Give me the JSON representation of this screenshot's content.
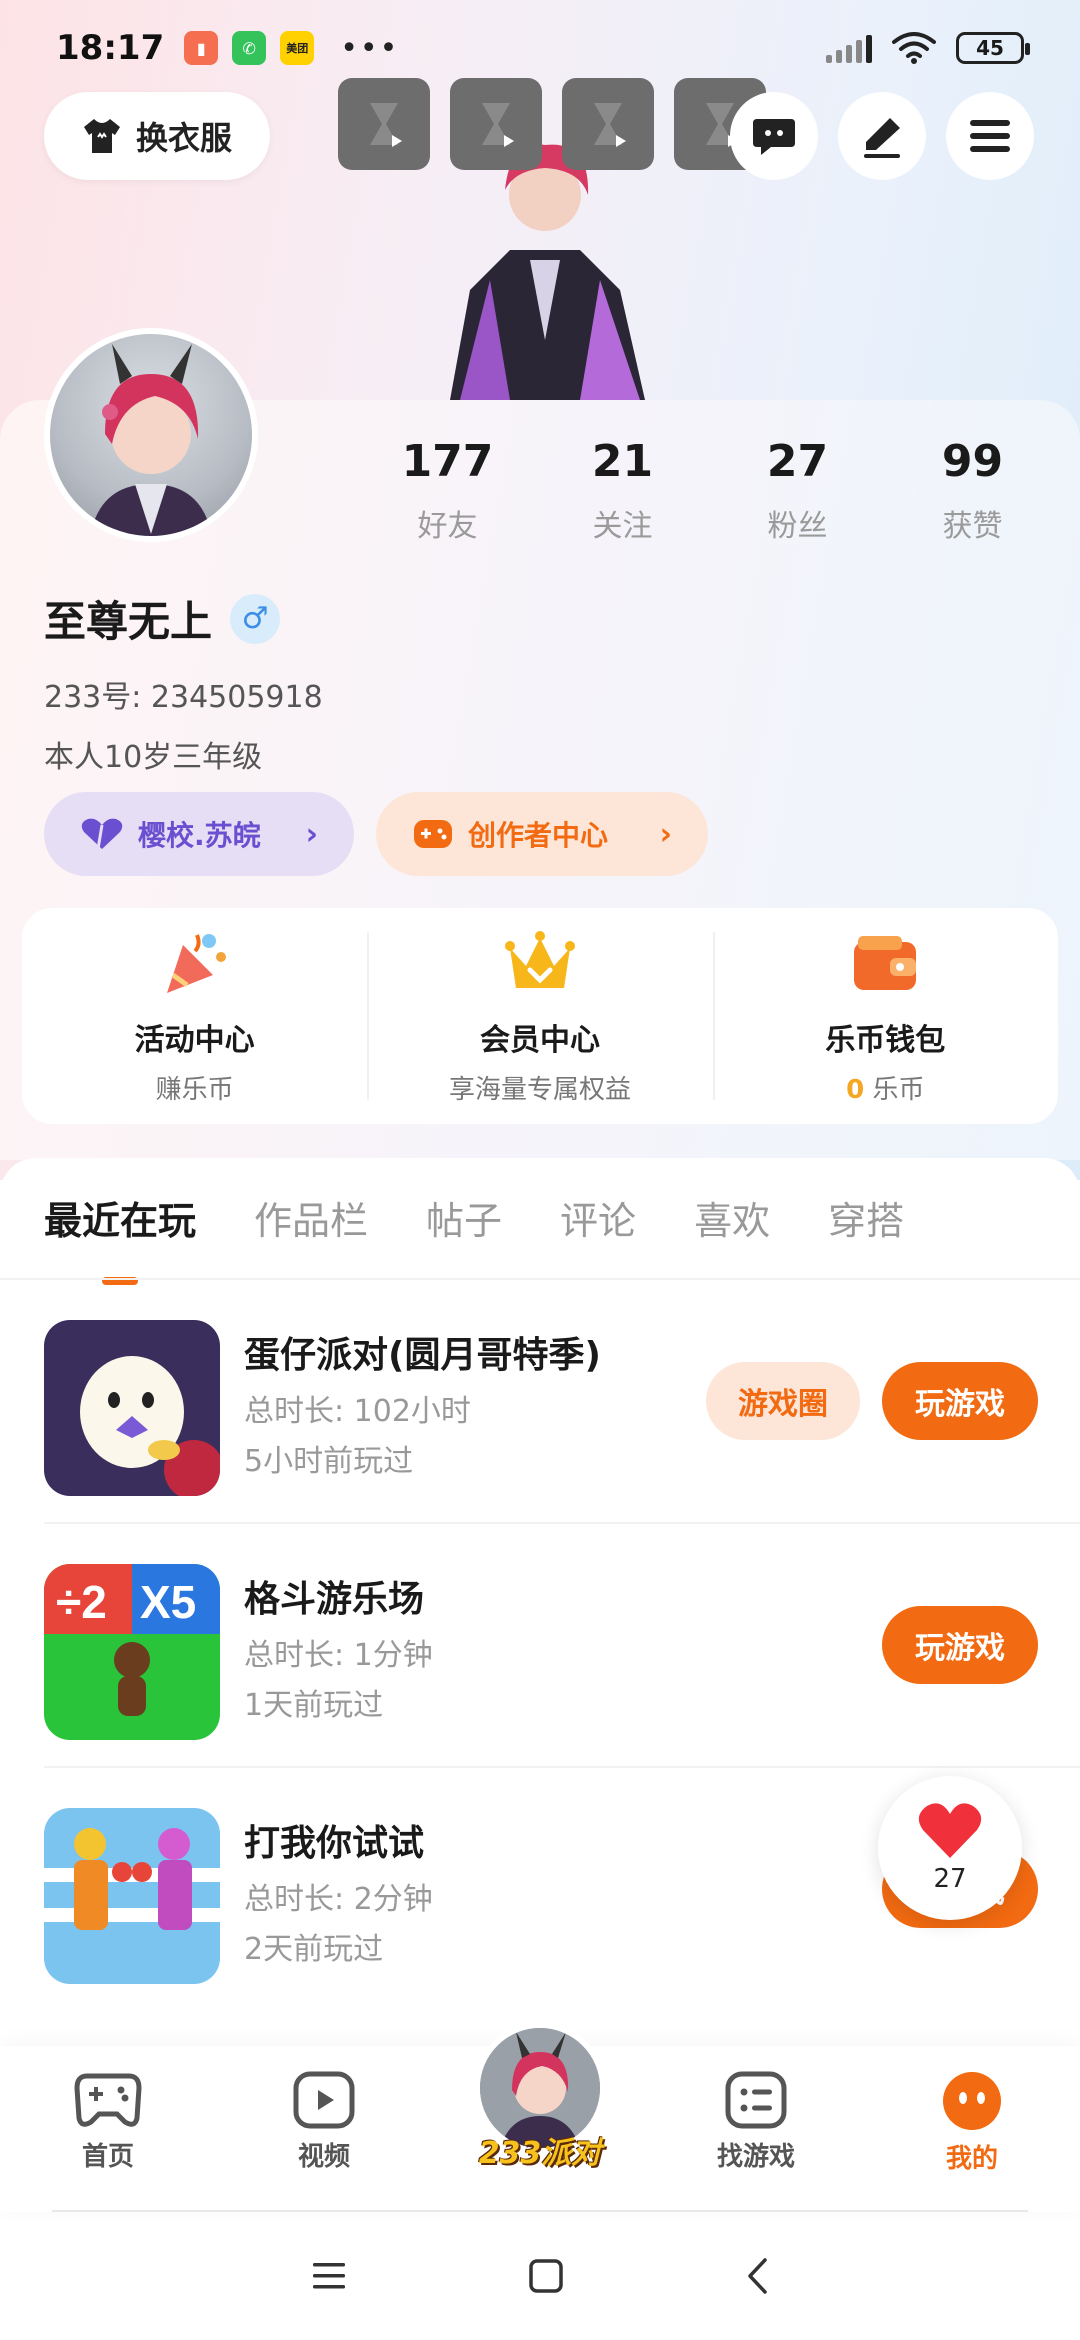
{
  "status_bar": {
    "time": "18:17",
    "meituan_label": "美团",
    "battery": "45"
  },
  "header": {
    "outfit_label": "换衣服"
  },
  "profile": {
    "stats": [
      {
        "value": "177",
        "label": "好友"
      },
      {
        "value": "21",
        "label": "关注"
      },
      {
        "value": "27",
        "label": "粉丝"
      },
      {
        "value": "99",
        "label": "获赞"
      }
    ],
    "username": "至尊无上",
    "gender_symbol": "♂",
    "user_id": "233号: 234505918",
    "bio": "本人10岁三年级",
    "school_label": "樱校.苏皖",
    "creator_label": "创作者中心"
  },
  "services": [
    {
      "title": "活动中心",
      "subtitle": "赚乐币"
    },
    {
      "title": "会员中心",
      "subtitle": "享海量专属权益"
    },
    {
      "title": "乐币钱包",
      "subtitle_value": "0",
      "subtitle_unit": "乐币"
    }
  ],
  "tabs": [
    "最近在玩",
    "作品栏",
    "帖子",
    "评论",
    "喜欢",
    "穿搭"
  ],
  "games": [
    {
      "name": "蛋仔派对(圆月哥特季)",
      "duration": "总时长: 102小时",
      "last_played": "5小时前玩过",
      "community_label": "游戏圈",
      "play_label": "玩游戏"
    },
    {
      "name": "格斗游乐场",
      "duration": "总时长: 1分钟",
      "last_played": "1天前玩过",
      "play_label": "玩游戏"
    },
    {
      "name": "打我你试试",
      "duration": "总时长: 2分钟",
      "last_played": "2天前玩过",
      "play_label": "玩游戏"
    }
  ],
  "game2_icon_text": {
    "left": "÷2",
    "right": "X5"
  },
  "floating_heart": {
    "count": "27"
  },
  "bottom_nav": {
    "home": "首页",
    "video": "视频",
    "center_brand": "233派对",
    "find_game": "找游戏",
    "mine": "我的"
  },
  "colors": {
    "accent": "#f26a11",
    "school_text": "#6b4fd1",
    "wallet_value": "#f5a623"
  }
}
